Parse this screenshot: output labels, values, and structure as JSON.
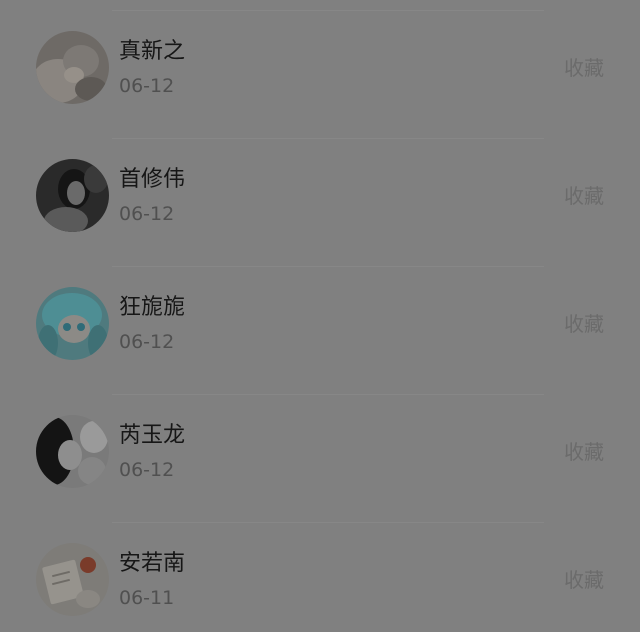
{
  "list": {
    "items": [
      {
        "name": "真新之",
        "date": "06-12",
        "action_label": "收藏"
      },
      {
        "name": "首修伟",
        "date": "06-12",
        "action_label": "收藏"
      },
      {
        "name": "狂旎旎",
        "date": "06-12",
        "action_label": "收藏"
      },
      {
        "name": "芮玉龙",
        "date": "06-12",
        "action_label": "收藏"
      },
      {
        "name": "安若南",
        "date": "06-11",
        "action_label": "收藏"
      }
    ]
  }
}
